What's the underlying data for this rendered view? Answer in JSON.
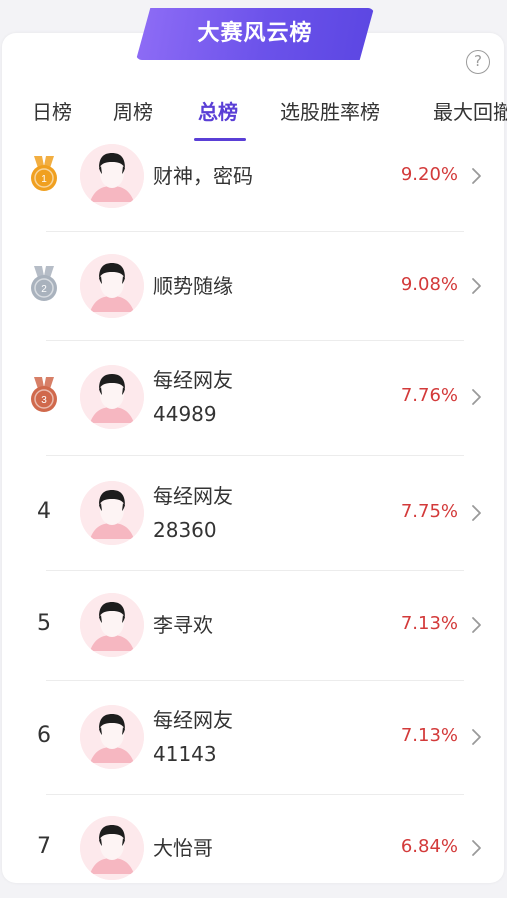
{
  "banner": {
    "title": "大赛风云榜"
  },
  "help": {
    "label": "?"
  },
  "tabs": [
    {
      "label": "日榜"
    },
    {
      "label": "周榜"
    },
    {
      "label": "总榜"
    },
    {
      "label": "选股胜率榜"
    },
    {
      "label": "最大回撤"
    }
  ],
  "active_tab": "总榜",
  "ranking": [
    {
      "rank": "1",
      "medal": "gold",
      "name": "财神，密码",
      "name_line2": "",
      "return_pct": "9.20%"
    },
    {
      "rank": "2",
      "medal": "silver",
      "name": "顺势随缘",
      "name_line2": "",
      "return_pct": "9.08%"
    },
    {
      "rank": "3",
      "medal": "bronze",
      "name": "每经网友",
      "name_line2": "44989",
      "return_pct": "7.76%"
    },
    {
      "rank": "4",
      "medal": "",
      "name": "每经网友",
      "name_line2": "28360",
      "return_pct": "7.75%"
    },
    {
      "rank": "5",
      "medal": "",
      "name": "李寻欢",
      "name_line2": "",
      "return_pct": "7.13%"
    },
    {
      "rank": "6",
      "medal": "",
      "name": "每经网友",
      "name_line2": "41143",
      "return_pct": "7.13%"
    },
    {
      "rank": "7",
      "medal": "",
      "name": "大怡哥",
      "name_line2": "",
      "return_pct": "6.84%"
    }
  ],
  "medal_numbers": {
    "gold": "1",
    "silver": "2",
    "bronze": "3"
  },
  "colors": {
    "accent": "#5a3fd6",
    "return_positive": "#d33a3a",
    "medal_gold": "#f0a020",
    "medal_silver": "#a9b2bd",
    "medal_bronze": "#d0694c"
  }
}
